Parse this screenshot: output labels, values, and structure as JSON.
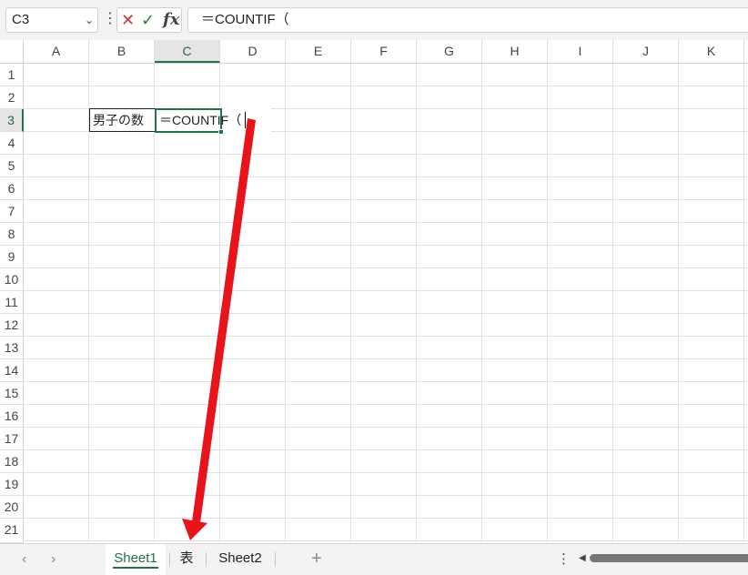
{
  "formula_bar": {
    "name_box": "C3",
    "name_box_chevron": "chevron-down-icon",
    "more_icon": "⋮",
    "cancel_symbol": "✕",
    "enter_symbol": "✓",
    "fx_symbol": "fx",
    "formula": "＝COUNTIF（"
  },
  "columns": [
    "A",
    "B",
    "C",
    "D",
    "E",
    "F",
    "G",
    "H",
    "I",
    "J",
    "K"
  ],
  "rows": [
    "1",
    "2",
    "3",
    "4",
    "5",
    "6",
    "7",
    "8",
    "9",
    "10",
    "11",
    "12",
    "13",
    "14",
    "15",
    "16",
    "17",
    "18",
    "19",
    "20",
    "21"
  ],
  "active_cell": {
    "column": "C",
    "row": "3"
  },
  "cells": {
    "B3": "男子の数",
    "C3": "＝COUNTIF（"
  },
  "sheet_tabs": {
    "prev_symbol": "‹",
    "next_symbol": "›",
    "tabs": [
      "Sheet1",
      "表",
      "Sheet2"
    ],
    "active": "Sheet1",
    "add_symbol": "+",
    "more_symbol": "⋮",
    "scroll_left_symbol": "◀"
  },
  "colors": {
    "accent": "#217346",
    "arrow": "#e8141b"
  }
}
